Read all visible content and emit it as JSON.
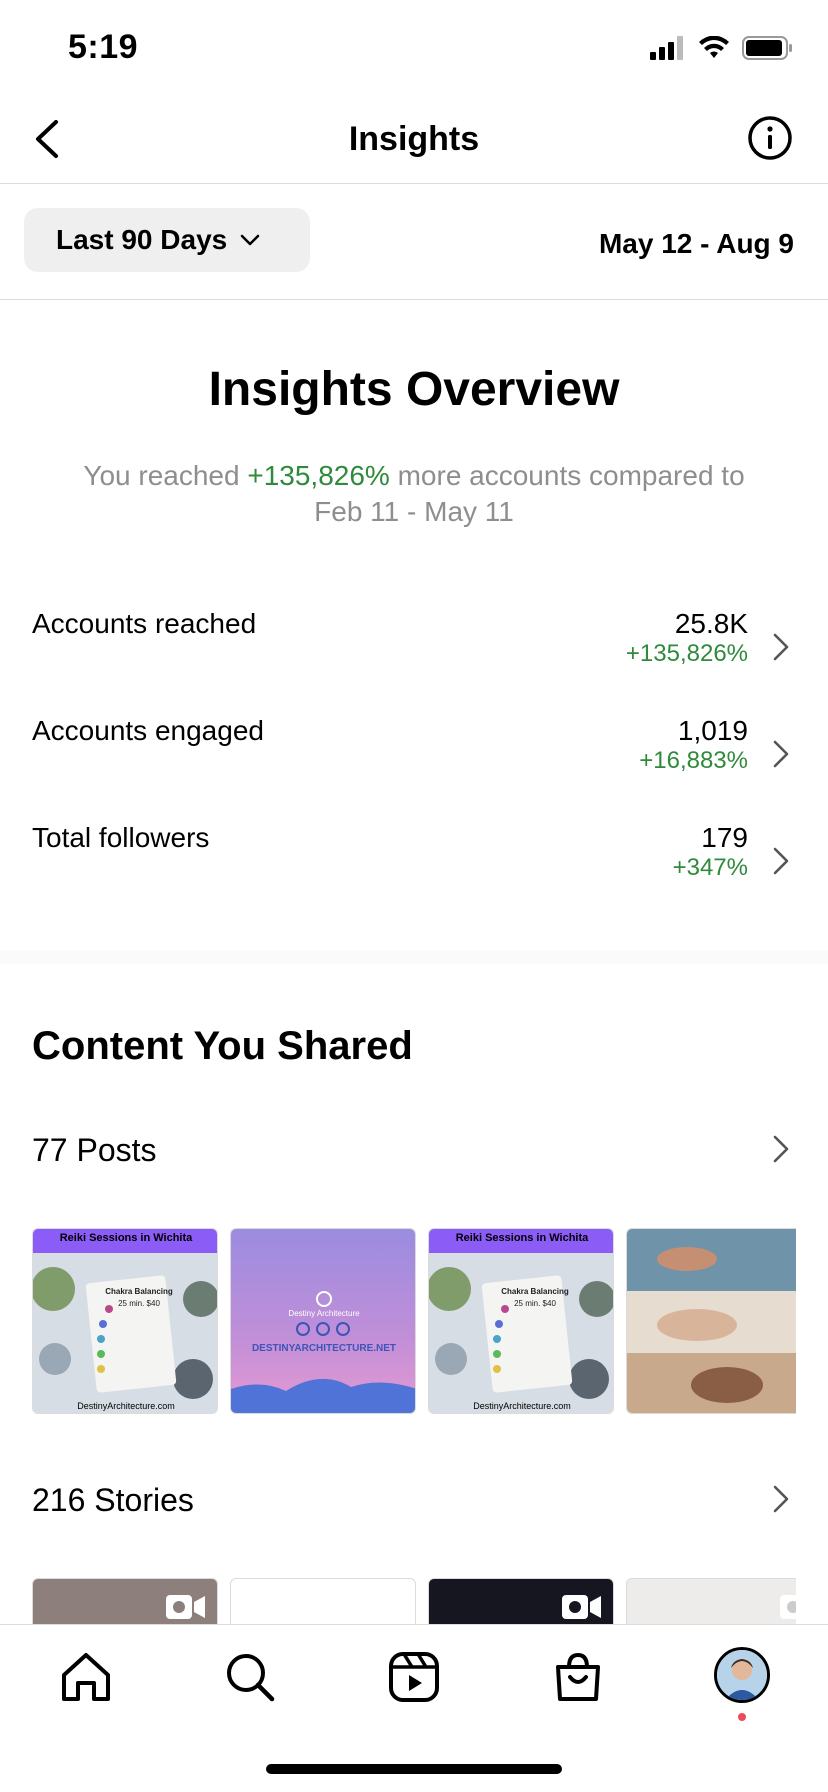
{
  "status_bar": {
    "time": "5:19"
  },
  "nav": {
    "title": "Insights"
  },
  "filter": {
    "range_label": "Last 90 Days",
    "date_range": "May 12 - Aug 9"
  },
  "overview": {
    "title": "Insights Overview",
    "subtitle_prefix": "You reached ",
    "subtitle_highlight": "+135,826%",
    "subtitle_suffix": " more accounts compared to Feb 11 - May 11",
    "metrics": [
      {
        "label": "Accounts reached",
        "value": "25.8K",
        "change": "+135,826%"
      },
      {
        "label": "Accounts engaged",
        "value": "1,019",
        "change": "+16,883%"
      },
      {
        "label": "Total followers",
        "value": "179",
        "change": "+347%"
      }
    ]
  },
  "content": {
    "title": "Content You Shared",
    "posts_label": "77 Posts",
    "stories_label": "216 Stories",
    "post_thumbs": [
      {
        "banner": "Reiki Sessions in Wichita",
        "card_title": "Chakra Balancing",
        "card_sub": "25 min. $40",
        "footer": "DestinyArchitecture.com"
      },
      {
        "brand": "Destiny Architecture",
        "url_text": "DESTINYARCHITECTURE.NET"
      },
      {
        "banner": "Reiki Sessions in Wichita",
        "card_title": "Chakra Balancing",
        "card_sub": "25 min. $40",
        "footer": "DestinyArchitecture.com"
      },
      {
        "kind": "photo-collage"
      }
    ]
  },
  "colors": {
    "positive": "#2f8a3b",
    "muted": "#8e8e8e",
    "notification": "#ed4956"
  },
  "tabbar": {
    "items": [
      {
        "icon": "home-icon"
      },
      {
        "icon": "search-icon"
      },
      {
        "icon": "reels-icon"
      },
      {
        "icon": "shop-icon"
      },
      {
        "icon": "profile-avatar"
      }
    ]
  }
}
